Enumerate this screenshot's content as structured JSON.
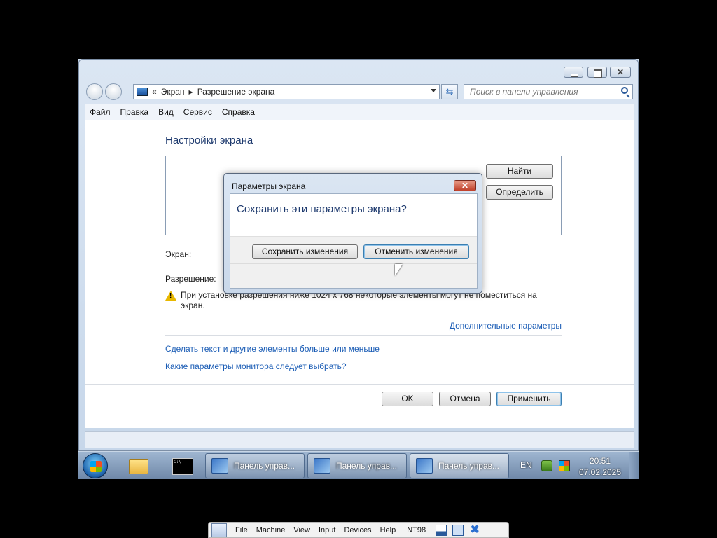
{
  "window": {
    "close_glyph": "✕"
  },
  "address": {
    "prefix": "«",
    "crumbs": [
      "Экран",
      "Разрешение экрана"
    ],
    "sep_glyph": "▶",
    "refresh_glyph": "⇆"
  },
  "search": {
    "placeholder": "Поиск в панели управления"
  },
  "menu": [
    "Файл",
    "Правка",
    "Вид",
    "Сервис",
    "Справка"
  ],
  "content": {
    "title": "Настройки экрана",
    "find_btn": "Найти",
    "identify_btn": "Определить",
    "screen_label": "Экран:",
    "resolution_label": "Разрешение:",
    "warning_glyph": "!",
    "warning_text": "При установке разрешения ниже 1024 x 768 некоторые элементы могут не поместиться на экран.",
    "advanced_link": "Дополнительные параметры",
    "text_size_link": "Сделать текст и другие элементы больше или меньше",
    "monitor_link": "Какие параметры монитора следует выбрать?",
    "ok_btn": "OK",
    "cancel_btn": "Отмена",
    "apply_btn": "Применить"
  },
  "dialog": {
    "title": "Параметры экрана",
    "close_glyph": "✕",
    "question": "Сохранить эти параметры экрана?",
    "save_btn": "Сохранить изменения",
    "revert_btn": "Отменить изменения"
  },
  "taskbar": {
    "tasks": [
      {
        "label": "Панель управ..."
      },
      {
        "label": "Панель управ..."
      },
      {
        "label": "Панель управ..."
      }
    ],
    "active_task_index": 2,
    "language": "EN",
    "time": "20:51",
    "date": "07.02.2025"
  },
  "vm_toolbar": {
    "menus": [
      "File",
      "Machine",
      "View",
      "Input",
      "Devices",
      "Help"
    ],
    "vm_name": "NT98",
    "close_glyph": "✖"
  },
  "colors": {
    "link": "#1a5cb5",
    "title_blue": "#1e3a6e",
    "dialog_close_red": "#c0402a",
    "default_button_border": "#3c7fb1"
  },
  "icons": [
    "back-arrow-icon",
    "forward-arrow-icon",
    "monitor-icon",
    "refresh-icon",
    "search-icon",
    "warning-icon",
    "windows-logo-icon",
    "folder-icon",
    "command-prompt-icon",
    "control-panel-icon",
    "network-icon",
    "action-center-icon",
    "pin-icon",
    "minimize-icon",
    "restore-icon",
    "close-icon",
    "mouse-cursor-icon"
  ]
}
